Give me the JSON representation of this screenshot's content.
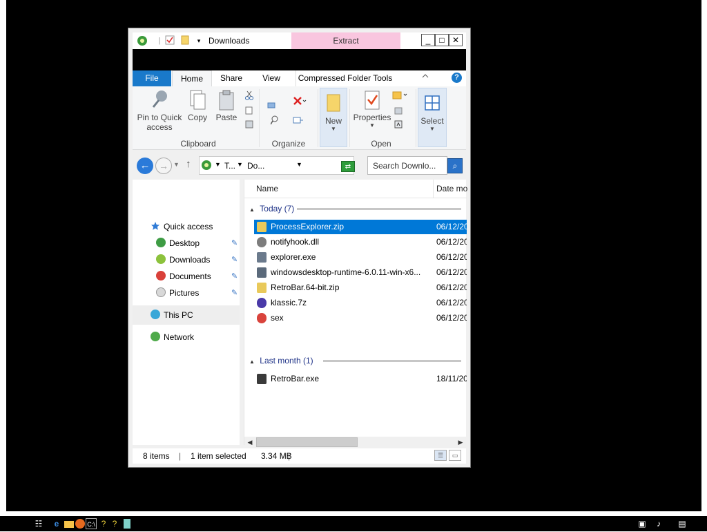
{
  "window": {
    "title": "Downloads",
    "contextual_tab": "Extract",
    "controls": {
      "minimize": "_",
      "maximize": "□",
      "close": "✕"
    }
  },
  "ribbon": {
    "tabs": {
      "file": "File",
      "home": "Home",
      "share": "Share",
      "view": "View",
      "compressed": "Compressed Folder Tools"
    },
    "clipboard": {
      "pin_label_1": "Pin to Quick",
      "pin_label_2": "access",
      "copy": "Copy",
      "paste": "Paste",
      "group": "Clipboard"
    },
    "organize": {
      "group": "Organize"
    },
    "new": {
      "label": "New"
    },
    "open": {
      "properties": "Properties",
      "group": "Open"
    },
    "select": {
      "label": "Select"
    }
  },
  "address": {
    "segment_1": "T...",
    "segment_2": "Do...",
    "search_placeholder": "Search Downlo..."
  },
  "nav_pane": {
    "quick_access": "Quick access",
    "desktop": "Desktop",
    "downloads": "Downloads",
    "documents": "Documents",
    "pictures": "Pictures",
    "this_pc": "This PC",
    "network": "Network"
  },
  "columns": {
    "name": "Name",
    "date": "Date mo"
  },
  "groups": {
    "today": "Today (7)",
    "last_month": "Last month (1)"
  },
  "files": [
    {
      "name": "ProcessExplorer.zip",
      "date": "06/12/20",
      "icon": "zip-folder-icon",
      "selected": true
    },
    {
      "name": "notifyhook.dll",
      "date": "06/12/20",
      "icon": "dll-gear-icon",
      "selected": false
    },
    {
      "name": "explorer.exe",
      "date": "06/12/20",
      "icon": "exe-window-icon",
      "selected": false
    },
    {
      "name": "windowsdesktop-runtime-6.0.11-win-x6...",
      "date": "06/12/20",
      "icon": "installer-icon",
      "selected": false
    },
    {
      "name": "RetroBar.64-bit.zip",
      "date": "06/12/20",
      "icon": "zip-folder-icon",
      "selected": false
    },
    {
      "name": "klassic.7z",
      "date": "06/12/20",
      "icon": "archive-icon",
      "selected": false
    },
    {
      "name": "sex",
      "date": "06/12/20",
      "icon": "generic-file-icon",
      "selected": false
    },
    {
      "name": "RetroBar.exe",
      "date": "18/11/20",
      "icon": "app-icon",
      "selected": false
    }
  ],
  "status": {
    "count": "8 items",
    "selection": "1 item selected",
    "size": "3.34 MB"
  },
  "colors": {
    "accent": "#0078d7",
    "file_tab": "#1979ca",
    "extract_tab": "#f9c6df",
    "desktop": "#000000"
  }
}
